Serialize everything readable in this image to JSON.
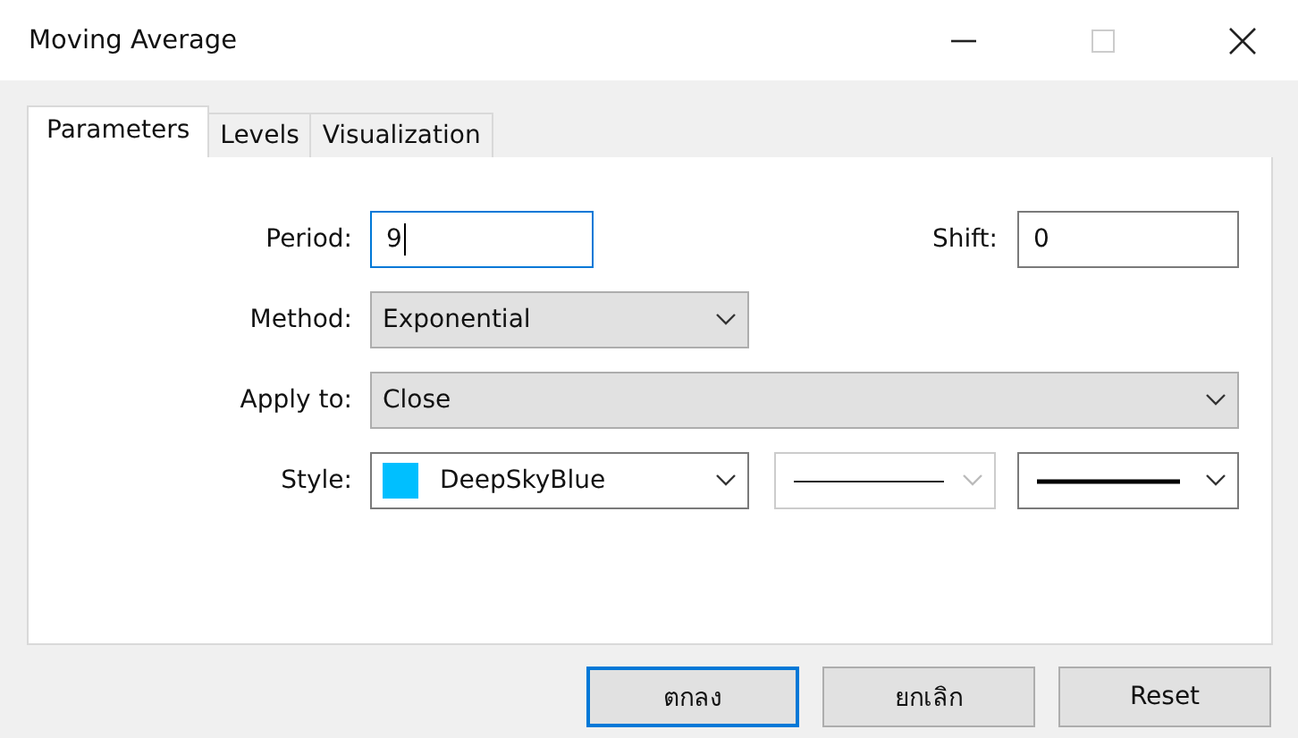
{
  "window": {
    "title": "Moving Average"
  },
  "tabs": [
    {
      "label": "Parameters",
      "selected": true
    },
    {
      "label": "Levels",
      "selected": false
    },
    {
      "label": "Visualization",
      "selected": false
    }
  ],
  "period": {
    "label": "Period:",
    "value": "9",
    "focused": true
  },
  "shift": {
    "label": "Shift:",
    "value": "0",
    "focused": false
  },
  "method": {
    "label": "Method:",
    "value": "Exponential"
  },
  "apply_to": {
    "label": "Apply to:",
    "value": "Close"
  },
  "style": {
    "label": "Style:",
    "color_name": "DeepSkyBlue",
    "color": "#00bfff",
    "line_style_disabled": true,
    "line_width_disabled": false
  },
  "buttons": [
    {
      "label": "ตกลง",
      "default": true
    },
    {
      "label": "ยกเลิก",
      "default": false
    },
    {
      "label": "Reset",
      "default": false
    }
  ]
}
